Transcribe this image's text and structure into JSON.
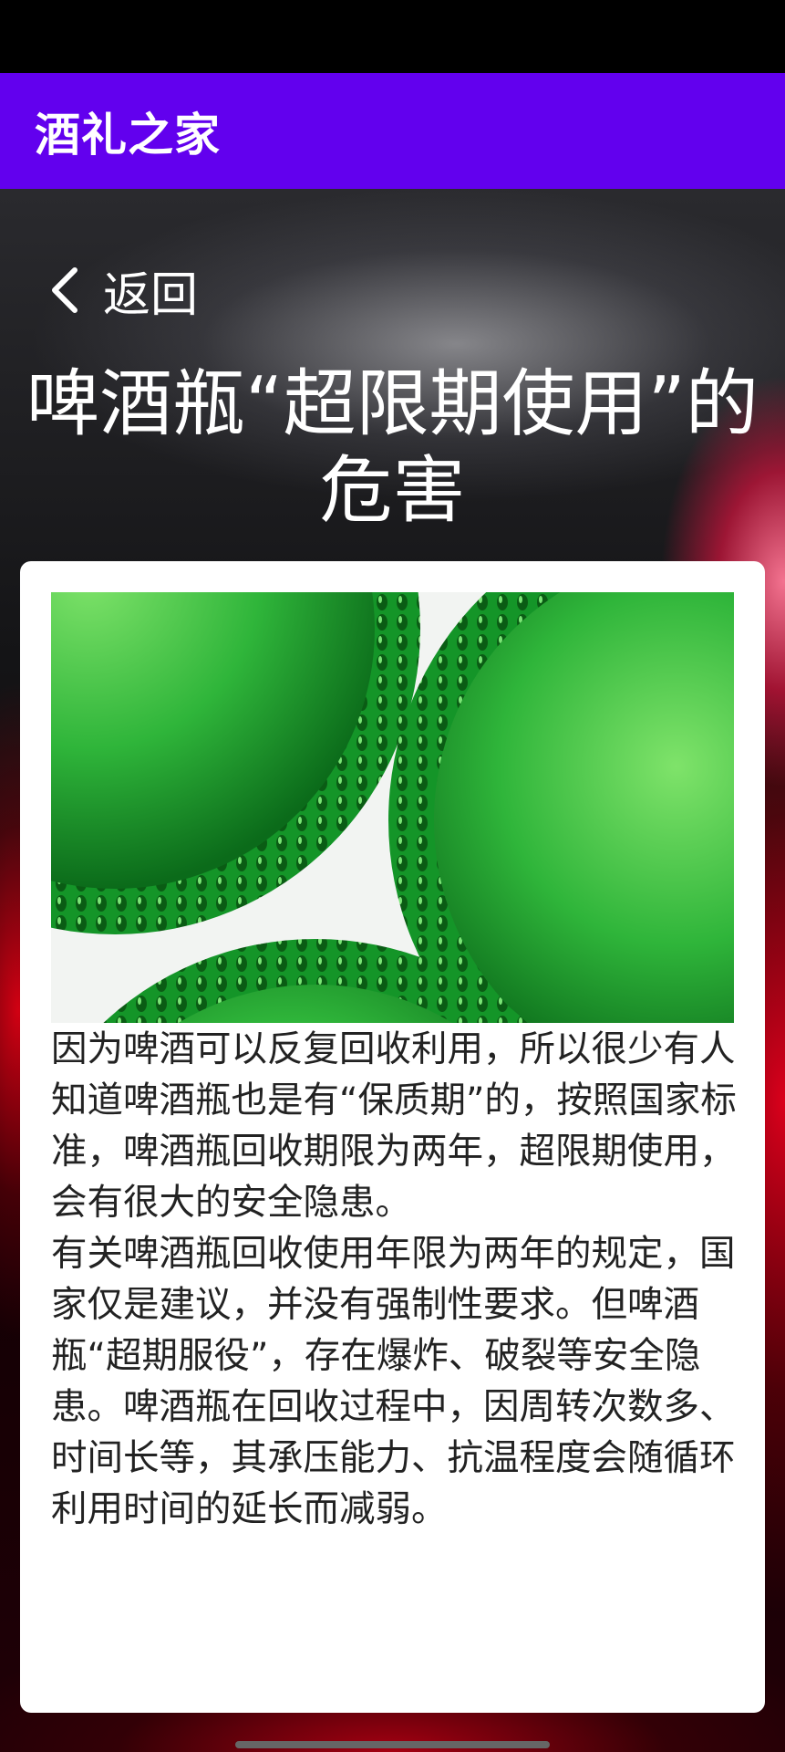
{
  "app_bar": {
    "title": "酒礼之家"
  },
  "nav": {
    "back_label": "返回",
    "back_icon": "chevron-left-icon"
  },
  "article": {
    "title": "啤酒瓶“超限期使用”的危害",
    "image": "green-beer-bottle-bottoms",
    "paragraphs": [
      "因为啤酒可以反复回收利用，所以很少有人知道啤酒瓶也是有“保质期”的，按照国家标准，啤酒瓶回收期限为两年，超限期使用，会有很大的安全隐患。",
      "有关啤酒瓶回收使用年限为两年的规定，国家仅是建议，并没有强制性要求。但啤酒瓶“超期服役”，存在爆炸、破裂等安全隐患。啤酒瓶在回收过程中，因周转次数多、时间长等，其承压能力、抗温程度会随循环利用时间的延长而减弱。"
    ]
  },
  "colors": {
    "app_bar": "#6200ee",
    "status_bar": "#000000",
    "card": "#ffffff",
    "text_light": "#ffffff",
    "text_dark": "#222222"
  }
}
